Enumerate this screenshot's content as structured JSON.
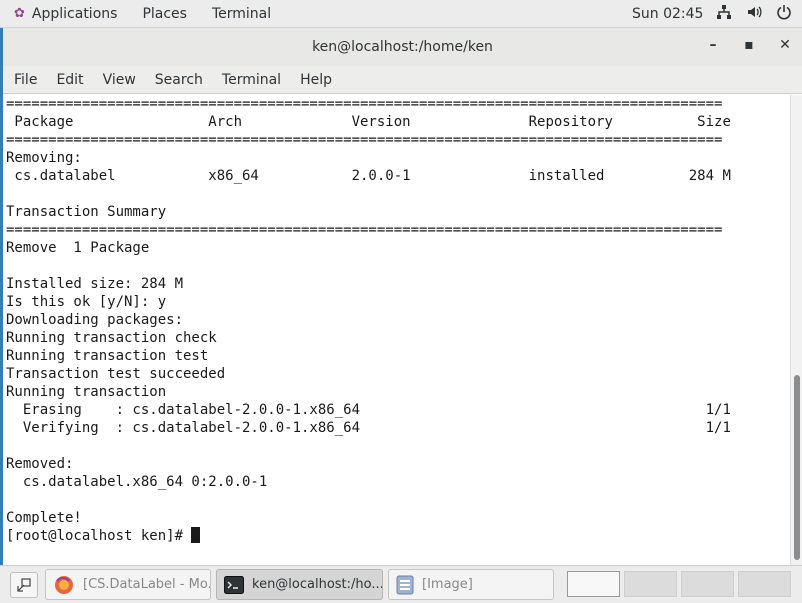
{
  "topbar": {
    "applications": "Applications",
    "places": "Places",
    "terminal": "Terminal",
    "clock": "Sun 02:45",
    "icons": [
      "network-icon",
      "volume-icon",
      "power-icon"
    ]
  },
  "window": {
    "title": "ken@localhost:/home/ken",
    "controls": {
      "minimize": "–",
      "maximize": "▪",
      "close": "✕"
    },
    "menu": [
      "File",
      "Edit",
      "View",
      "Search",
      "Terminal",
      "Help"
    ]
  },
  "terminal": {
    "lines": [
      "=====================================================================================",
      " Package                Arch             Version              Repository          Size",
      "=====================================================================================",
      "Removing:",
      " cs.datalabel           x86_64           2.0.0-1              installed          284 M",
      "",
      "Transaction Summary",
      "=====================================================================================",
      "Remove  1 Package",
      "",
      "Installed size: 284 M",
      "Is this ok [y/N]: y",
      "Downloading packages:",
      "Running transaction check",
      "Running transaction test",
      "Transaction test succeeded",
      "Running transaction",
      "  Erasing    : cs.datalabel-2.0.0-1.x86_64                                         1/1",
      "  Verifying  : cs.datalabel-2.0.0-1.x86_64                                         1/1",
      "",
      "Removed:",
      "  cs.datalabel.x86_64 0:2.0.0-1",
      "",
      "Complete!"
    ],
    "prompt": "[root@localhost ken]# "
  },
  "taskbar": {
    "tasks": [
      {
        "label": "[CS.DataLabel - Mo...",
        "icon": "firefox-icon",
        "active": false
      },
      {
        "label": "ken@localhost:/ho...",
        "icon": "terminal-icon",
        "active": true
      },
      {
        "label": "[Image]",
        "icon": "image-viewer-icon",
        "active": false
      }
    ]
  }
}
